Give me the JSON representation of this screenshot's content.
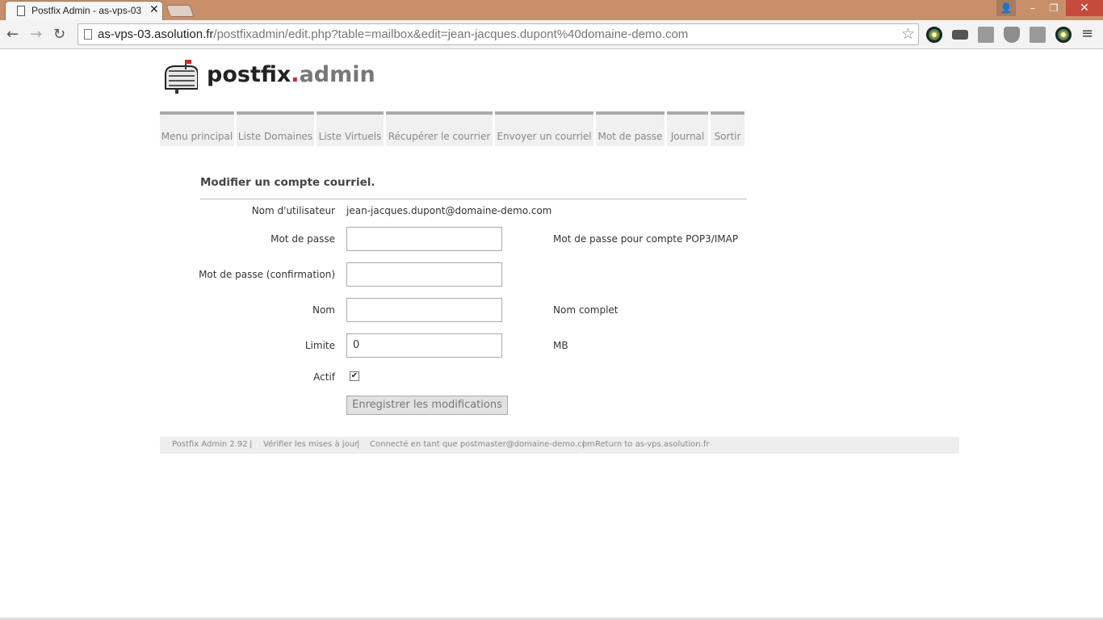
{
  "browser": {
    "tab_title": "Postfix Admin - as-vps-03",
    "tab_close": "✕",
    "url_host": "as-vps-03.asolution.fr",
    "url_path": "/postfixadmin/edit.php?table=mailbox&edit=jean-jacques.dupont%40domaine-demo.com",
    "back_icon": "←",
    "forward_icon": "→",
    "reload_icon": "↻",
    "star_icon": "☆",
    "menu_icon": "≡",
    "win_user": "👤",
    "win_min": "–",
    "win_max": "❐",
    "win_close": "✕",
    "extension_colors": [
      "#2a6db0",
      "#444444",
      "#888888",
      "#8a8a8a",
      "#888888",
      "#2b2b2b"
    ]
  },
  "logo": {
    "part1": "postfix",
    "dot": ".",
    "part2": "admin"
  },
  "menu": {
    "items": [
      "Menu principal",
      "Liste Domaines",
      "Liste Virtuels",
      "Récupérer le courrier",
      "Envoyer un courriel",
      "Mot de passe",
      "Journal",
      "Sortir"
    ]
  },
  "form": {
    "title": "Modifier un compte courriel.",
    "username_label": "Nom d'utilisateur",
    "username_value": "jean-jacques.dupont@domaine-demo.com",
    "password_label": "Mot de passe",
    "password_help": "Mot de passe pour compte POP3/IMAP",
    "password2_label": "Mot de passe (confirmation)",
    "name_label": "Nom",
    "name_help": "Nom complet",
    "quota_label": "Limite",
    "quota_value": "0",
    "quota_help": "MB",
    "active_label": "Actif",
    "active_checked": "✔",
    "submit_label": "Enregistrer les modifications"
  },
  "footer": {
    "version": "Postfix Admin 2.92",
    "sep1": "|",
    "check_updates": "Vérifier les mises à jour",
    "sep2": "|",
    "logged_in": "Connecté en tant que postmaster@domaine-demo.com",
    "sep3": "|",
    "return_link": "Return to as-vps.asolution.fr"
  }
}
